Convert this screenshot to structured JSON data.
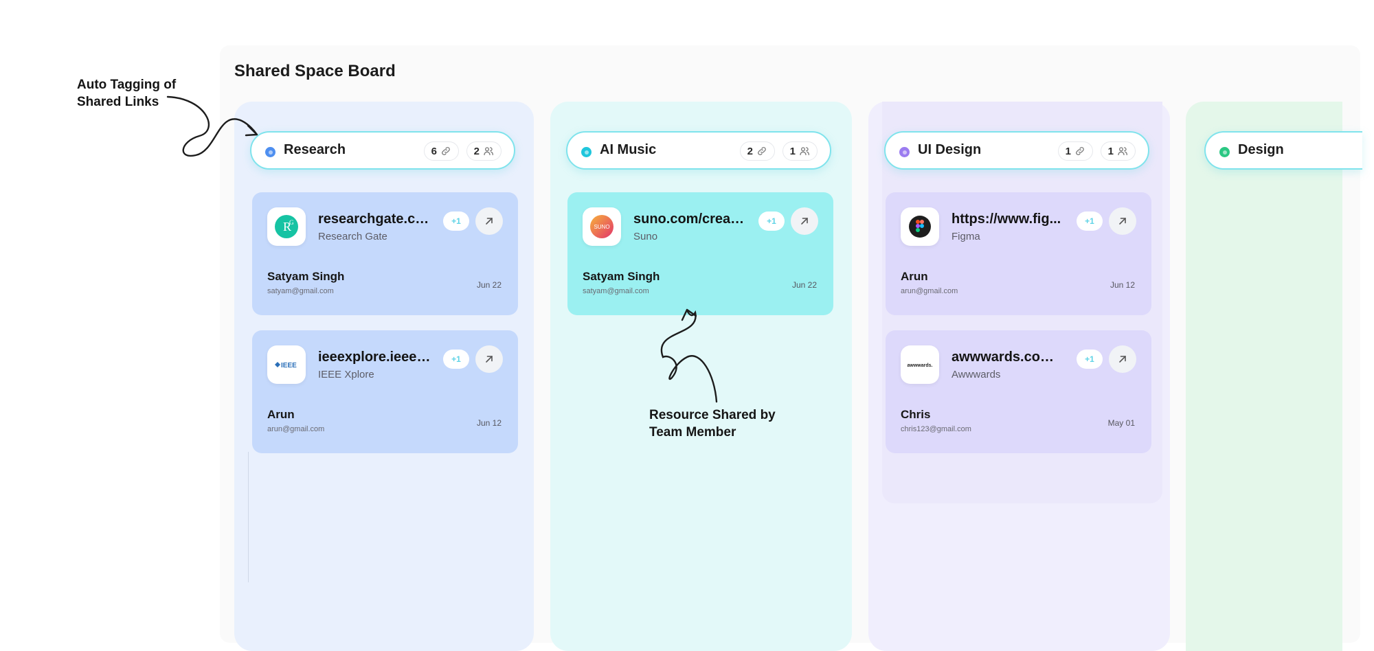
{
  "board": {
    "title": "Shared Space Board"
  },
  "annotations": {
    "auto_tagging": "Auto Tagging of\nShared Links",
    "resource_shared": "Resource Shared by\nTeam Member"
  },
  "columns": [
    {
      "name": "Research",
      "dot_color": "#4e8ff0",
      "links": "6",
      "members": "2",
      "cards": [
        {
          "url": "researchgate.co...",
          "site": "Research Gate",
          "badge": "+1",
          "member": "Satyam Singh",
          "email": "satyam@gmail.com",
          "date": "Jun 22",
          "icon": "researchgate-icon",
          "icon_text": "R"
        },
        {
          "url": "ieeexplore.ieee.o...",
          "site": "IEEE Xplore",
          "badge": "+1",
          "member": "Arun",
          "email": "arun@gmail.com",
          "date": "Jun 12",
          "icon": "ieee-icon",
          "icon_text": "IEEE"
        }
      ]
    },
    {
      "name": "AI Music",
      "dot_color": "#1fc6dc",
      "links": "2",
      "members": "1",
      "cards": [
        {
          "url": "suno.com/create...",
          "site": "Suno",
          "badge": "+1",
          "member": "Satyam Singh",
          "email": "satyam@gmail.com",
          "date": "Jun 22",
          "icon": "suno-icon",
          "icon_text": "SUNO"
        }
      ]
    },
    {
      "name": "UI Design",
      "dot_color": "#9b7cf0",
      "links": "1",
      "members": "1",
      "cards": [
        {
          "url": "https://www.fig...",
          "site": "Figma",
          "badge": "+1",
          "member": "Arun",
          "email": "arun@gmail.com",
          "date": "Jun 12",
          "icon": "figma-icon",
          "icon_text": ""
        },
        {
          "url": "awwwards.com/w",
          "site": "Awwwards",
          "badge": "+1",
          "member": "Chris",
          "email": "chris123@gmail.com",
          "date": "May 01",
          "icon": "awwwards-icon",
          "icon_text": "awwwards."
        }
      ]
    },
    {
      "name": "Design",
      "dot_color": "#2bc783"
    }
  ]
}
